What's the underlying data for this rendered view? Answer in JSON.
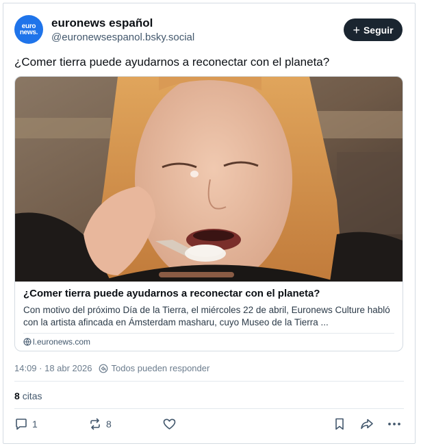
{
  "post": {
    "author": {
      "display_name": "euronews español",
      "handle": "@euronewsespanol.bsky.social",
      "avatar_line1": "euro",
      "avatar_line2": "news."
    },
    "follow_label": "Seguir",
    "text": "¿Comer tierra puede ayudarnos a reconectar con el planeta?",
    "embed": {
      "title": "¿Comer tierra puede ayudarnos a reconectar con el planeta?",
      "description": "Con motivo del próximo Día de la Tierra, el miércoles 22 de abril, Euronews Culture habló con la artista afincada en Ámsterdam masharu, cuyo Museo de la Tierra ...",
      "domain": "l.euronews.com"
    },
    "timestamp": "14:09 · 18 abr 2026",
    "reply_setting": "Todos pueden responder",
    "quotes_count": "8",
    "quotes_label": "citas",
    "actions": {
      "replies": "1",
      "reposts": "8"
    }
  },
  "colors": {
    "accent": "#1f74ea",
    "button_bg": "#1a2530",
    "border": "#d4dbe2"
  }
}
